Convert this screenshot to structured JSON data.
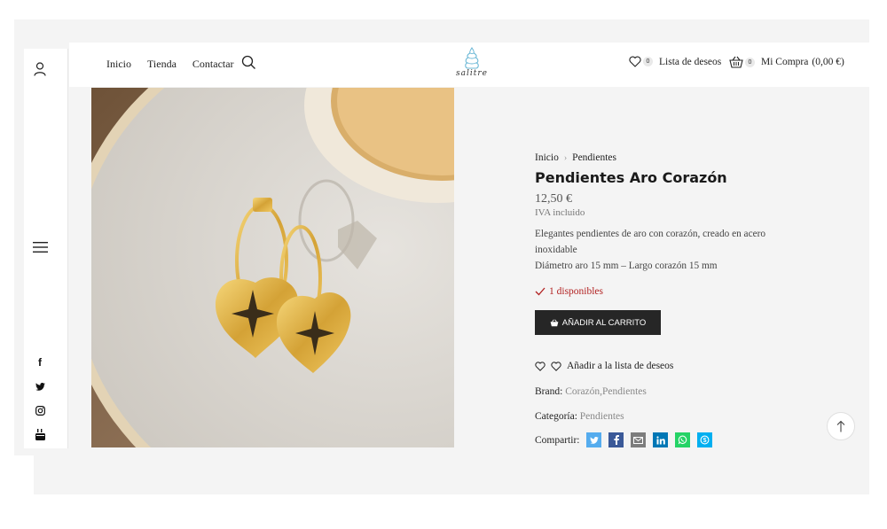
{
  "nav": {
    "home": "Inicio",
    "shop": "Tienda",
    "contact": "Contactar"
  },
  "logo": {
    "text": "salitre"
  },
  "header": {
    "wishlist_count": "0",
    "wishlist_label": "Lista de deseos",
    "cart_count": "0",
    "cart_label": "Mi Compra",
    "cart_total": "(0,00 €)"
  },
  "breadcrumb": {
    "home": "Inicio",
    "category": "Pendientes"
  },
  "product": {
    "title": "Pendientes Aro Corazón",
    "price": "12,50 €",
    "tax_note": "IVA incluido",
    "description_1": "Elegantes pendientes de aro con corazón, creado en acero inoxidable",
    "description_2": "Diámetro aro 15 mm – Largo corazón 15 mm",
    "stock": "1 disponibles",
    "add_to_cart": "AÑADIR AL CARRITO",
    "add_to_wishlist": "Añadir a la lista de deseos",
    "brand_label": "Brand:",
    "brand_value": "Corazón,Pendientes",
    "category_label": "Categoría:",
    "category_value": "Pendientes",
    "share_label": "Compartir:"
  },
  "sidebar": {
    "social": {
      "facebook": "f",
      "twitter": "t",
      "instagram": "instagram-icon",
      "youtube": "youtube-icon"
    }
  },
  "share_icons": {
    "twitter": "#55acee",
    "facebook": "#3b5998",
    "email": "#7d7d7d",
    "linkedin": "#0077b5",
    "whatsapp": "#25d366",
    "skype": "#00aff0"
  },
  "colors": {
    "accent_dark": "#262626",
    "stock_red": "#b22222",
    "logo_blue": "#6cb8d6"
  }
}
